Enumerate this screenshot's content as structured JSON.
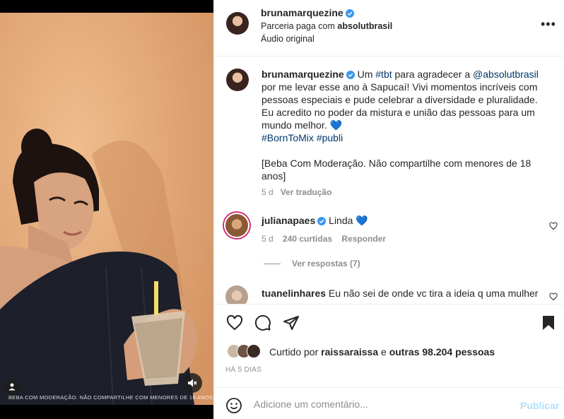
{
  "media": {
    "caption_overlay": "BEBA COM MODERAÇÃO. NÃO COMPARTILHE COM MENORES DE 18 ANOS",
    "user_tag_icon": "user-icon",
    "mute_icon": "speaker-muted-icon"
  },
  "header": {
    "username": "brunamarquezine",
    "partnership_prefix": "Parceria paga com",
    "partner": "absolutbrasil",
    "audio": "Áudio original",
    "more_icon": "more-options-icon"
  },
  "caption": {
    "username": "brunamarquezine",
    "part1": "Um",
    "hashtag_tbt": "#tbt",
    "part2": "para agradecer a",
    "mention": "@absolutbrasil",
    "part3": "por me levar esse ano à Sapucaí! Vivi momentos incríveis com pessoas especiais e pude celebrar a diversidade e pluralidade. Eu acredito no poder da mistura e união das pessoas para um mundo melhor.",
    "emoji": "💙",
    "hashtag1": "#BornToMix",
    "hashtag2": "#publi",
    "disclaimer": "[Beba Com Moderação. Não compartilhe com menores de 18 anos]",
    "age": "5 d",
    "translate": "Ver tradução"
  },
  "comments": [
    {
      "username": "julianapaes",
      "text": "Linda",
      "emoji": "💙",
      "age": "5 d",
      "likes": "240 curtidas",
      "reply": "Responder",
      "view_replies": "Ver respostas (7)"
    },
    {
      "username": "tuanelinhares",
      "text": "Eu não sei de onde vc tira a ideia q uma mulher"
    }
  ],
  "actions": {
    "like_icon": "heart-icon",
    "comment_icon": "comment-icon",
    "share_icon": "send-icon",
    "save_icon": "bookmark-icon",
    "liked_by_prefix": "Curtido por",
    "liked_by_user": "raissaraissa",
    "liked_by_and": "e",
    "liked_by_others": "outras 98.204 pessoas",
    "date": "HÁ 5 DIAS"
  },
  "composer": {
    "emoji_icon": "smiley-icon",
    "placeholder": "Adicione um comentário...",
    "publish": "Publicar"
  },
  "colors": {
    "verified": "#3897f0",
    "link": "#00376b",
    "muted": "#8e8e8e",
    "publish_disabled": "#b2dffc",
    "heart_blue": "#1d72d6"
  }
}
